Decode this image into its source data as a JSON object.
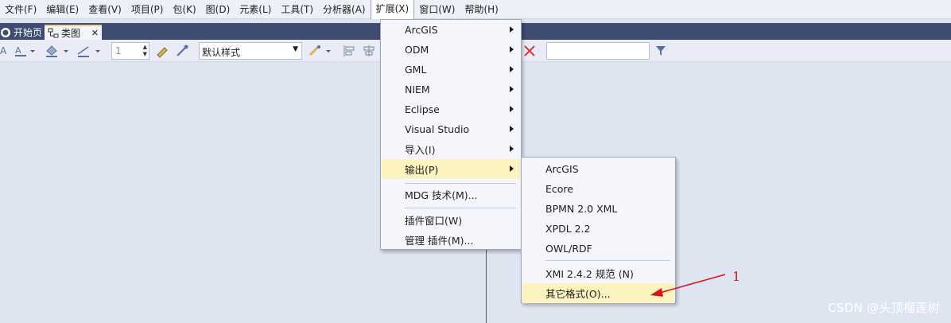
{
  "menubar": {
    "items": [
      "文件(F)",
      "编辑(E)",
      "查看(V)",
      "项目(P)",
      "包(K)",
      "图(D)",
      "元素(L)",
      "工具(T)",
      "分析器(A)",
      "扩展(X)",
      "窗口(W)",
      "帮助(H)"
    ],
    "open_item": "扩展(X)"
  },
  "tabs": {
    "home_label": "开始页",
    "class_label": "类图",
    "close_glyph": "✕"
  },
  "toolbar": {
    "line_width_value": "1",
    "style_value": "默认样式",
    "search_value": ""
  },
  "extension_menu": {
    "items": [
      "ArcGIS",
      "ODM",
      "GML",
      "NIEM",
      "Eclipse",
      "Visual Studio",
      "导入(I)",
      "输出(P)",
      "MDG 技术(M)...",
      "插件窗口(W)",
      "管理 插件(M)..."
    ],
    "highlighted": "输出(P)"
  },
  "export_submenu": {
    "items": [
      "ArcGIS",
      "Ecore",
      "BPMN 2.0 XML",
      "XPDL 2.2",
      "OWL/RDF",
      "XMI 2.4.2 规范 (N)",
      "其它格式(O)..."
    ],
    "highlighted": "其它格式(O)..."
  },
  "annotation": {
    "label": "1",
    "color": "#d8141b"
  },
  "watermark": "CSDN @头顶榴莲树",
  "colors": {
    "accent_tab": "#3e4b72",
    "highlight": "#fdf3bf",
    "canvas": "#dfe4f1"
  }
}
